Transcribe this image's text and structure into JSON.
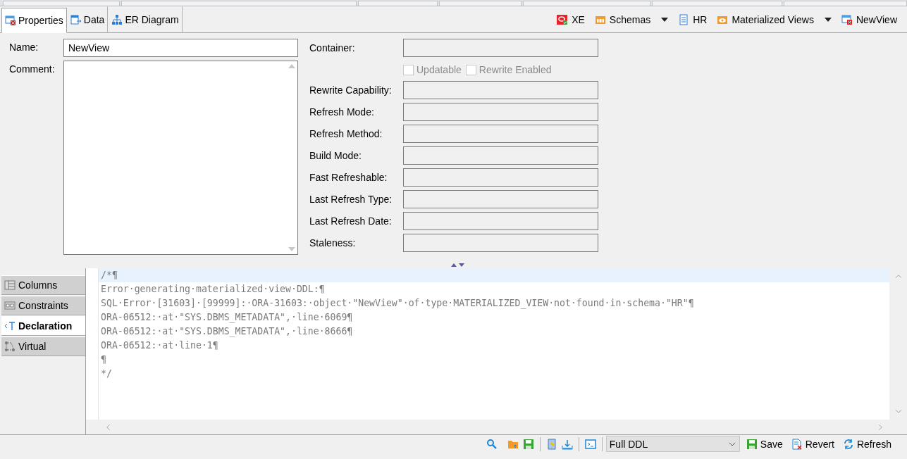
{
  "editor_tabs": [
    {
      "label": "Properties",
      "selected": true
    },
    {
      "label": "Data",
      "selected": false
    },
    {
      "label": "ER Diagram",
      "selected": false
    }
  ],
  "breadcrumb": [
    {
      "label": "XE",
      "dropdown": false
    },
    {
      "label": "Schemas",
      "dropdown": true
    },
    {
      "label": "HR",
      "dropdown": false
    },
    {
      "label": "Materialized Views",
      "dropdown": true
    },
    {
      "label": "NewView",
      "dropdown": false
    }
  ],
  "form": {
    "name": {
      "label": "Name:",
      "value": "NewView"
    },
    "comment": {
      "label": "Comment:"
    },
    "container": {
      "label": "Container:"
    },
    "checkboxes": [
      {
        "label": "Updatable",
        "checked": false,
        "disabled": true
      },
      {
        "label": "Rewrite Enabled",
        "checked": false,
        "disabled": true
      }
    ],
    "fields": [
      {
        "label": "Rewrite Capability:"
      },
      {
        "label": "Refresh Mode:"
      },
      {
        "label": "Refresh Method:"
      },
      {
        "label": "Build Mode:"
      },
      {
        "label": "Fast Refreshable:"
      },
      {
        "label": "Last Refresh Type:"
      },
      {
        "label": "Last Refresh Date:"
      },
      {
        "label": "Staleness:"
      }
    ]
  },
  "side_tabs": [
    {
      "label": "Columns",
      "selected": false
    },
    {
      "label": "Constraints",
      "selected": false
    },
    {
      "label": "Declaration",
      "selected": true
    },
    {
      "label": "Virtual",
      "selected": false
    }
  ],
  "ddl_lines": [
    {
      "text": "/*¶",
      "highlighted": true
    },
    {
      "text": "Error·generating·materialized·view·DDL:¶",
      "highlighted": false
    },
    {
      "text": "SQL·Error·[31603]·[99999]:·ORA-31603:·object·\"NewView\"·of·type·MATERIALIZED_VIEW·not·found·in·schema·\"HR\"¶",
      "highlighted": false
    },
    {
      "text": "ORA-06512:·at·\"SYS.DBMS_METADATA\",·line·6069¶",
      "highlighted": false
    },
    {
      "text": "ORA-06512:·at·\"SYS.DBMS_METADATA\",·line·8666¶",
      "highlighted": false
    },
    {
      "text": "ORA-06512:·at·line·1¶",
      "highlighted": false
    },
    {
      "text": "¶",
      "highlighted": false
    },
    {
      "text": "*/",
      "highlighted": false
    }
  ],
  "footer": {
    "format": "Full DDL",
    "buttons": [
      "Save",
      "Revert",
      "Refresh"
    ]
  }
}
